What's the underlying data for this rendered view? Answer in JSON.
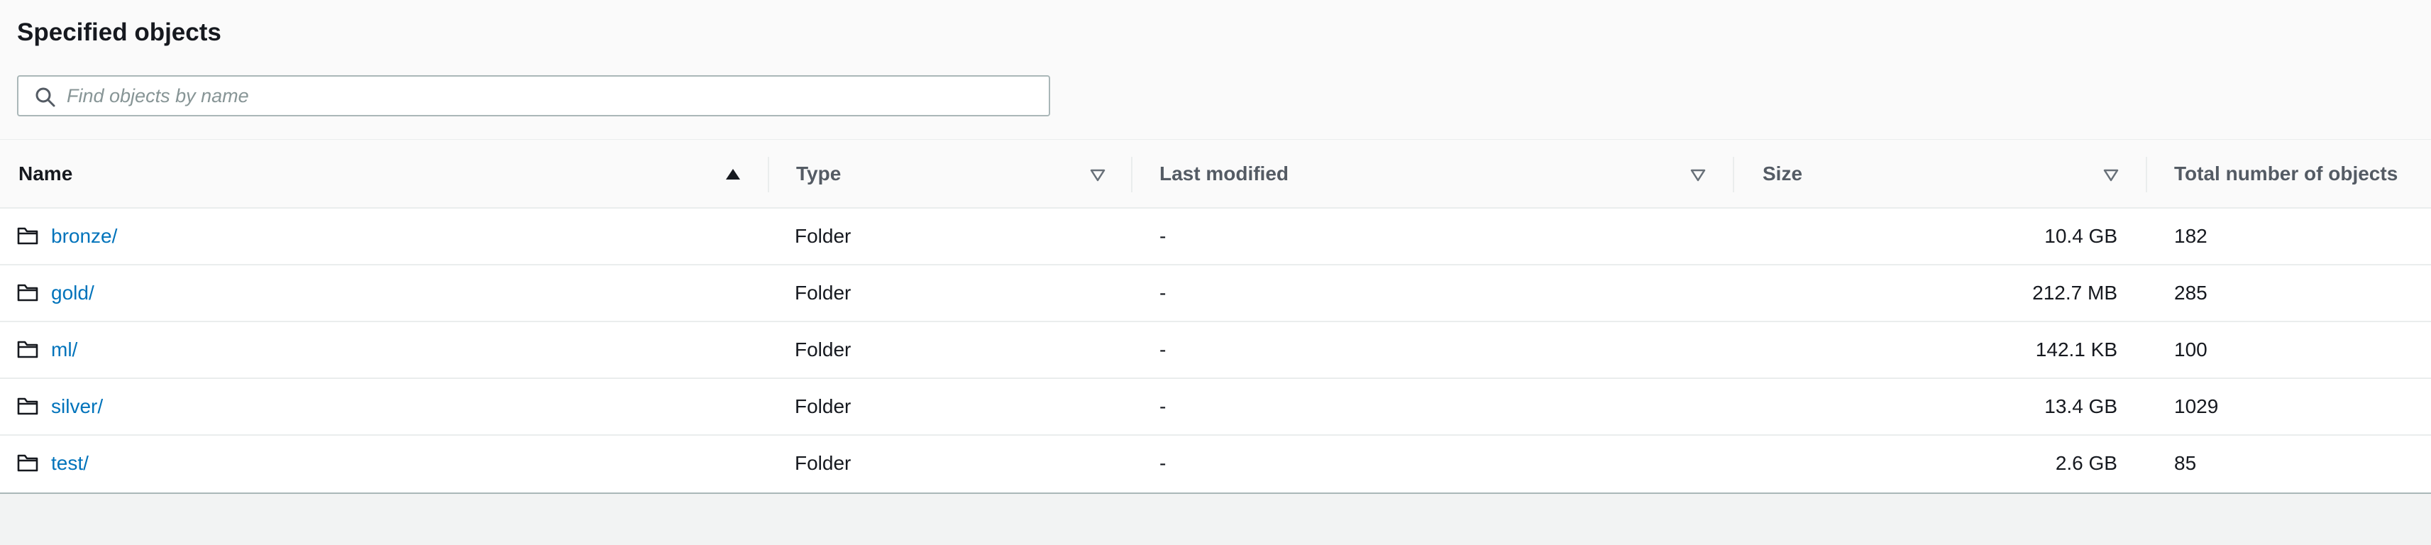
{
  "panel": {
    "title": "Specified objects"
  },
  "search": {
    "placeholder": "Find objects by name",
    "value": ""
  },
  "table": {
    "columns": [
      {
        "key": "name",
        "label": "Name",
        "sort": "ascending"
      },
      {
        "key": "type",
        "label": "Type",
        "sort": "none"
      },
      {
        "key": "last_modified",
        "label": "Last modified",
        "sort": "none"
      },
      {
        "key": "size",
        "label": "Size",
        "sort": "none"
      },
      {
        "key": "total_objects",
        "label": "Total number of objects",
        "sort": "none"
      }
    ],
    "rows": [
      {
        "name": "bronze/",
        "type": "Folder",
        "last_modified": "-",
        "size": "10.4 GB",
        "total_objects": "182",
        "icon": "folder-icon"
      },
      {
        "name": "gold/",
        "type": "Folder",
        "last_modified": "-",
        "size": "212.7 MB",
        "total_objects": "285",
        "icon": "folder-icon"
      },
      {
        "name": "ml/",
        "type": "Folder",
        "last_modified": "-",
        "size": "142.1 KB",
        "total_objects": "100",
        "icon": "folder-icon"
      },
      {
        "name": "silver/",
        "type": "Folder",
        "last_modified": "-",
        "size": "13.4 GB",
        "total_objects": "1029",
        "icon": "folder-icon"
      },
      {
        "name": "test/",
        "type": "Folder",
        "last_modified": "-",
        "size": "2.6 GB",
        "total_objects": "85",
        "icon": "folder-icon"
      }
    ]
  },
  "colors": {
    "link": "#0073bb",
    "text": "#16191f",
    "header_text": "#545b64",
    "border": "#eaeded",
    "background": "#f2f3f3"
  },
  "icons": {
    "search": "search-icon",
    "folder": "folder-icon",
    "sort_ascending": "sort-ascending-icon",
    "sort_none": "sort-descending-outline-icon"
  }
}
